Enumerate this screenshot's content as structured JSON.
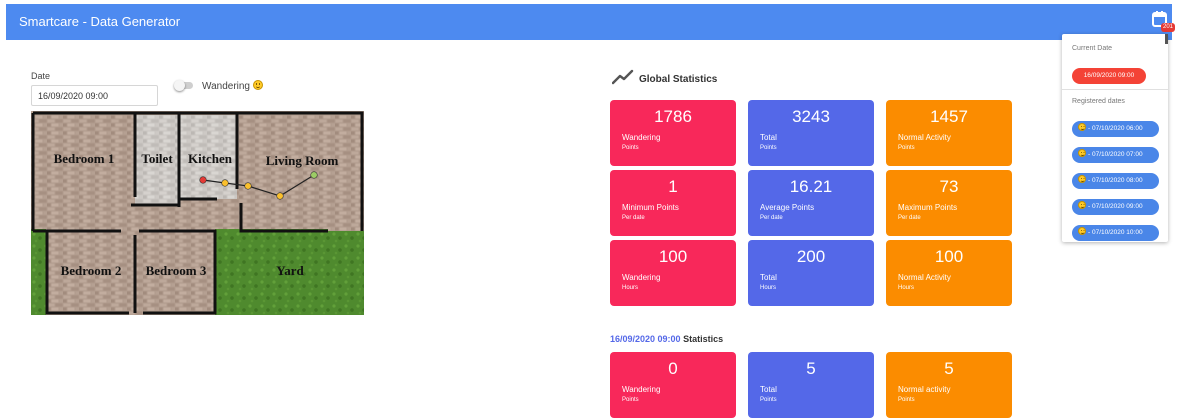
{
  "header": {
    "title": "Smartcare - Data Generator",
    "calendar_icon": "calendar-icon",
    "badge": "201"
  },
  "colors": {
    "header": "#4d8af0",
    "red": "#f8285a",
    "blue": "#5468e8",
    "orange": "#fb8c00"
  },
  "form": {
    "date_label": "Date",
    "date_value": "16/09/2020 09:00",
    "wandering_label": "Wandering",
    "wandering_on": false
  },
  "floorplan": {
    "rooms": [
      "Bedroom 1",
      "Toilet",
      "Kitchen",
      "Living Room",
      "Bedroom 2",
      "Bedroom 3",
      "Yard"
    ]
  },
  "global": {
    "title": "Global Statistics",
    "cards": [
      {
        "value": "1786",
        "label": "Wandering",
        "sub": "Points"
      },
      {
        "value": "3243",
        "label": "Total",
        "sub": "Points"
      },
      {
        "value": "1457",
        "label": "Normal Activity",
        "sub": "Points"
      },
      {
        "value": "1",
        "label": "Minimum Points",
        "sub": "Per date"
      },
      {
        "value": "16.21",
        "label": "Average Points",
        "sub": "Per date"
      },
      {
        "value": "73",
        "label": "Maximum Points",
        "sub": "Per date"
      },
      {
        "value": "100",
        "label": "Wandering",
        "sub": "Hours"
      },
      {
        "value": "200",
        "label": "Total",
        "sub": "Hours"
      },
      {
        "value": "100",
        "label": "Normal Activity",
        "sub": "Hours"
      }
    ]
  },
  "date_stats": {
    "date": "16/09/2020 09:00",
    "title": "Statistics",
    "cards": [
      {
        "value": "0",
        "label": "Wandering",
        "sub": "Points"
      },
      {
        "value": "5",
        "label": "Total",
        "sub": "Points"
      },
      {
        "value": "5",
        "label": "Normal activity",
        "sub": "Points"
      }
    ]
  },
  "dropdown": {
    "current_label": "Current Date",
    "current_value": "16/09/2020 09:00",
    "registered_label": "Registered dates",
    "dates": [
      "- 07/10/2020 06:00",
      "- 07/10/2020 07:00",
      "- 07/10/2020 08:00",
      "- 07/10/2020 09:00",
      "- 07/10/2020 10:00"
    ]
  }
}
